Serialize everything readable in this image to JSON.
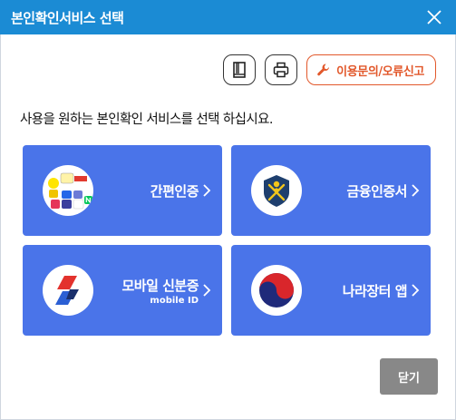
{
  "window": {
    "title": "본인확인서비스 선택",
    "close_icon": "close-icon"
  },
  "toolbar": {
    "book_icon": "book-icon",
    "print_icon": "print-icon",
    "report_label": "이용문의/오류신고",
    "report_icon": "wrench-icon",
    "report_color": "#e2582b"
  },
  "instruction": "사용을 원하는 본인확인 서비스를 선택 하십시요.",
  "options": [
    {
      "label": "간편인증",
      "sub": "",
      "icon": "simple-auth-logos-icon"
    },
    {
      "label": "금융인증서",
      "sub": "",
      "icon": "financial-cert-shield-icon"
    },
    {
      "label": "모바일 신분증",
      "sub": "mobile ID",
      "icon": "mobile-id-icon"
    },
    {
      "label": "나라장터 앱",
      "sub": "",
      "icon": "taegeuk-icon"
    }
  ],
  "colors": {
    "titlebar": "#1b8bd4",
    "card": "#4a74e9",
    "close_button": "#888888"
  },
  "footer": {
    "close_label": "닫기"
  }
}
